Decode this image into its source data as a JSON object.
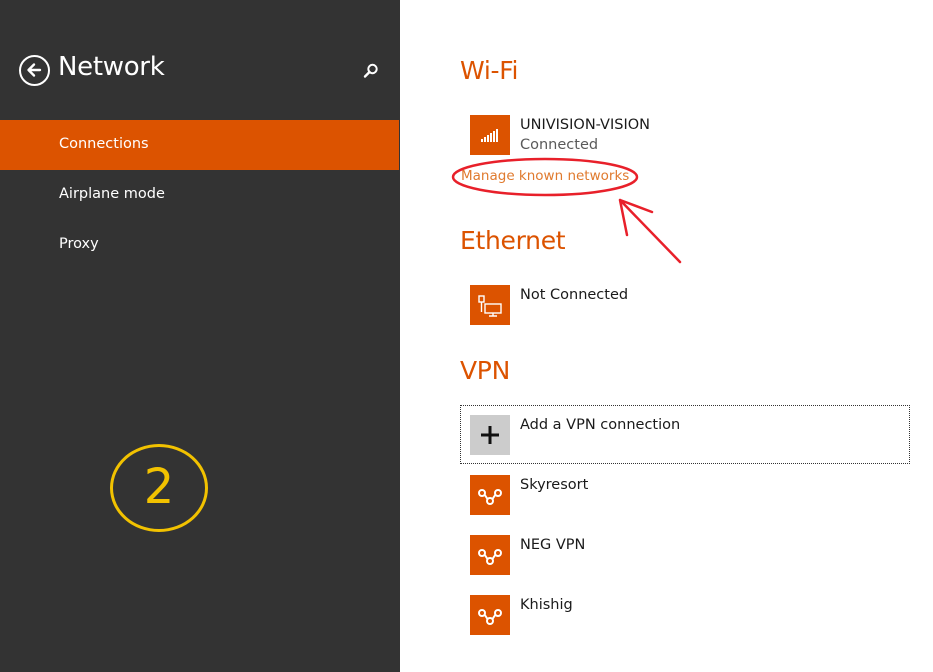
{
  "sidebar": {
    "title": "Network",
    "items": [
      {
        "label": "Connections",
        "active": true
      },
      {
        "label": "Airplane mode",
        "active": false
      },
      {
        "label": "Proxy",
        "active": false
      }
    ],
    "annotation_number": "2"
  },
  "wifi": {
    "title": "Wi-Fi",
    "network_name": "UNIVISION-VISION",
    "network_status": "Connected",
    "manage_link": "Manage known networks"
  },
  "ethernet": {
    "title": "Ethernet",
    "status": "Not Connected"
  },
  "vpn": {
    "title": "VPN",
    "add_label": "Add a VPN connection",
    "connections": [
      "Skyresort",
      "NEG VPN",
      "Khishig"
    ]
  },
  "colors": {
    "accent": "#dc5300",
    "sidebar_bg": "#333333",
    "annotation_red": "#e8202a",
    "annotation_yellow": "#f2c200"
  },
  "icons": {
    "back": "back-arrow-icon",
    "search": "search-icon",
    "wifi": "wifi-signal-icon",
    "ethernet": "ethernet-icon",
    "add": "plus-icon",
    "vpn": "vpn-icon"
  }
}
